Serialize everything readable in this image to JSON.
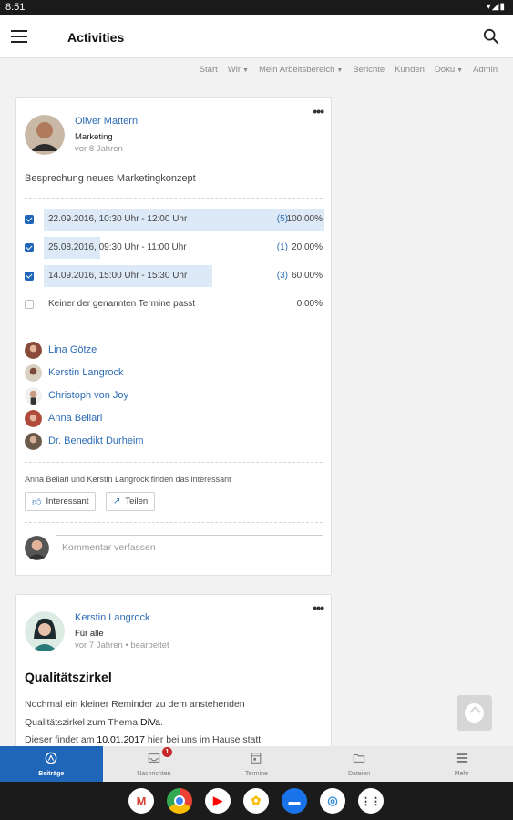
{
  "status": {
    "time": "8:51",
    "icons": "▾◢▮"
  },
  "appbar": {
    "title": "Activities"
  },
  "topnav": [
    {
      "label": "Start",
      "dropdown": false
    },
    {
      "label": "Wir",
      "dropdown": true
    },
    {
      "label": "Mein Arbeitsbereich",
      "dropdown": true
    },
    {
      "label": "Berichte",
      "dropdown": false
    },
    {
      "label": "Kunden",
      "dropdown": false
    },
    {
      "label": "Doku",
      "dropdown": true
    },
    {
      "label": "Admin",
      "dropdown": false
    }
  ],
  "post1": {
    "author": "Oliver Mattern",
    "group": "Marketing",
    "time": "vor 8 Jahren",
    "subject": "Besprechung neues Marketingkonzept",
    "poll": [
      {
        "label": "22.09.2016, 10:30 Uhr - 12:00 Uhr",
        "count": "(5)",
        "pct": "100.00%",
        "fraction": 1.0,
        "checked": true
      },
      {
        "label": "25.08.2016, 09:30 Uhr - 11:00 Uhr",
        "count": "(1)",
        "pct": "20.00%",
        "fraction": 0.2,
        "checked": true
      },
      {
        "label": "14.09.2016, 15:00 Uhr - 15:30 Uhr",
        "count": "(3)",
        "pct": "60.00%",
        "fraction": 0.6,
        "checked": true
      },
      {
        "label": "Keiner der genannten Termine passt",
        "count": "",
        "pct": "0.00%",
        "fraction": 0,
        "checked": false
      }
    ],
    "voters": [
      "Lina Götze",
      "Kerstin Langrock",
      "Christoph von Joy",
      "Anna Bellari",
      "Dr. Benedikt Durheim"
    ],
    "likes_text": "Anna Bellari und Kerstin Langrock finden das interessant",
    "like_label": "Interessant",
    "share_label": "Teilen",
    "comment_placeholder": "Kommentar verfassen"
  },
  "post2": {
    "author": "Kerstin Langrock",
    "group": "Für alle",
    "time": "vor 7 Jahren • bearbeitet",
    "title": "Qualitätszirkel",
    "body_1": "Nochmal ein kleiner Reminder zu dem anstehenden",
    "body_2a": "Qualitätszirkel zum Thema ",
    "body_2b": "DiVa",
    "body_2c": ".",
    "body_3a": "Dieser findet am ",
    "body_3b": "10.01.2017",
    "body_3c": " hier bei uns im Hause statt."
  },
  "bottomnav": [
    {
      "label": "Beiträge",
      "active": true
    },
    {
      "label": "Nachrichten",
      "badge": "1"
    },
    {
      "label": "Termine"
    },
    {
      "label": "Dateien"
    },
    {
      "label": "Mehr"
    }
  ],
  "dock": [
    "gmail",
    "chrome",
    "youtube",
    "photos",
    "messages",
    "safari-like",
    "apps"
  ],
  "colors": {
    "accent": "#1f66b8",
    "link": "#2e6db4",
    "bar": "#dde9f6",
    "badge": "#c62828"
  }
}
